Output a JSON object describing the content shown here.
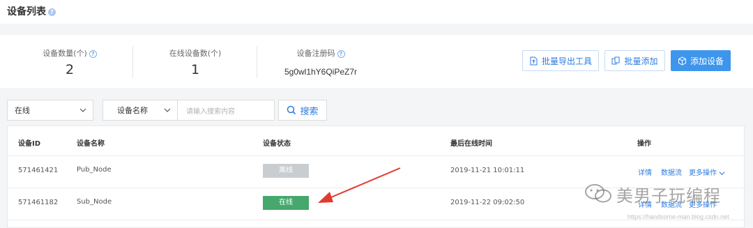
{
  "header": {
    "title": "设备列表",
    "help_glyph": "?"
  },
  "stats": {
    "device_count": {
      "label": "设备数量(个)",
      "value": "2"
    },
    "online_count": {
      "label": "在线设备数(个)",
      "value": "1"
    },
    "reg_code": {
      "label": "设备注册码",
      "value": "5g0wl1hY6QiPeZ7r"
    }
  },
  "toolbar": {
    "export_label": "批量导出工具",
    "batch_add_label": "批量添加",
    "add_device_label": "添加设备"
  },
  "filters": {
    "status_selected": "在线",
    "field_selected": "设备名称",
    "search_placeholder": "请输入搜索内容",
    "search_label": "搜索"
  },
  "table": {
    "columns": [
      "设备ID",
      "设备名称",
      "设备状态",
      "最后在线时间",
      "操作"
    ],
    "rows": [
      {
        "id": "571461421",
        "name": "Pub_Node",
        "status": "离线",
        "last_online": "2019-11-21 10:01:11",
        "actions": [
          "详情",
          "数据流",
          "更多操作"
        ]
      },
      {
        "id": "571461182",
        "name": "Sub_Node",
        "status": "在线",
        "last_online": "2019-11-22 09:02:50",
        "actions": [
          "详情",
          "数据流",
          "更多操作"
        ]
      }
    ]
  },
  "watermark": {
    "text": "美男子玩编程",
    "url": "https://handsome-man.blog.csdn.net"
  },
  "colors": {
    "accent": "#2d7be0",
    "primary_button": "#3e95ec",
    "online": "#46a86c",
    "offline": "#c9cdd1"
  },
  "icons": [
    "help-icon",
    "export-icon",
    "batch-add-icon",
    "add-device-icon",
    "chevron-down-icon",
    "search-icon",
    "wechat-icon",
    "arrow-annotation"
  ]
}
